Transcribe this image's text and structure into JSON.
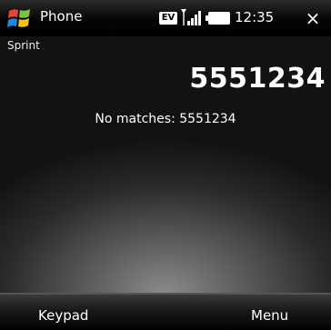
{
  "titlebar": {
    "app_title": "Phone",
    "network_badge": "EV",
    "time": "12:35",
    "close_glyph": "×"
  },
  "main": {
    "carrier": "Sprint",
    "dialed_number": "5551234",
    "match_status": "No matches: 5551234"
  },
  "softkeys": {
    "left": "Keypad",
    "right": "Menu"
  },
  "colors": {
    "accent_windows_red": "#e8462a",
    "accent_windows_green": "#7cc142",
    "accent_windows_blue": "#1e88e5",
    "accent_windows_yellow": "#f4c21b"
  },
  "icons": [
    "windows-start-icon",
    "signal-icon",
    "battery-icon",
    "close-icon"
  ]
}
